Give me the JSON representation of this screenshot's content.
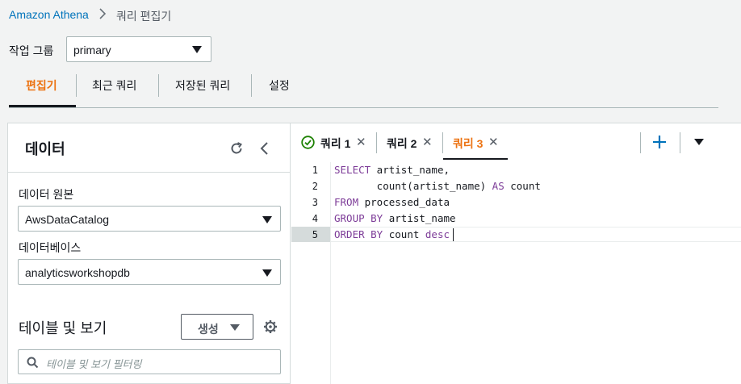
{
  "breadcrumb": {
    "link": "Amazon Athena",
    "current": "쿼리 편집기"
  },
  "workgroup": {
    "label": "작업 그룹",
    "value": "primary"
  },
  "main_tabs": [
    {
      "label": "편집기",
      "active": true
    },
    {
      "label": "최근 쿼리",
      "active": false
    },
    {
      "label": "저장된 쿼리",
      "active": false
    },
    {
      "label": "설정",
      "active": false
    }
  ],
  "data_panel": {
    "title": "데이터",
    "data_source_label": "데이터 원본",
    "data_source_value": "AwsDataCatalog",
    "database_label": "데이터베이스",
    "database_value": "analyticsworkshopdb",
    "tables_title": "테이블 및 보기",
    "create_label": "생성",
    "filter_placeholder": "테이블 및 보기 필터링"
  },
  "query_tabs": [
    {
      "label": "쿼리 1",
      "status": "success"
    },
    {
      "label": "쿼리 2"
    },
    {
      "label": "쿼리 3",
      "active": true
    }
  ],
  "editor": {
    "active_line": 5,
    "lines": [
      {
        "no": "1",
        "kw1": "SELECT",
        "rest": " artist_name,"
      },
      {
        "no": "2",
        "pre": "       count(artist_name) ",
        "kw1": "AS",
        "rest": " count"
      },
      {
        "no": "3",
        "kw1": "FROM",
        "rest": " processed_data"
      },
      {
        "no": "4",
        "kw1": "GROUP BY",
        "rest": " artist_name"
      },
      {
        "no": "5",
        "kw1": "ORDER BY",
        "rest": " count ",
        "kw2": "desc"
      }
    ]
  },
  "colors": {
    "accent": "#ec7211",
    "link": "#0073bb",
    "success": "#1d8102",
    "keyword": "#7d3c98"
  }
}
